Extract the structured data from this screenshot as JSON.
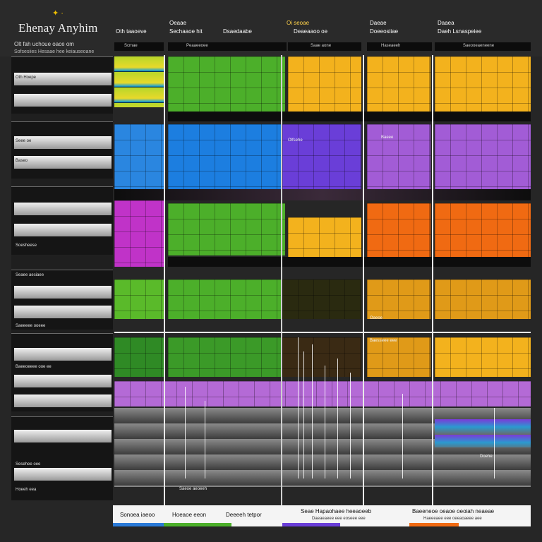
{
  "brand": {
    "title": "Ehenay Anyhim",
    "subtitle": "Olt fah uchoue oace om",
    "subtitle2": "Sofsesiies  Hesaae hee keiauseoane"
  },
  "columns": [
    {
      "title": "Oth taaoeve",
      "sub": "Scmae"
    },
    {
      "title": "Oeaae",
      "title2": "Sechaaoe hit",
      "title3": "Dsaedaabe"
    },
    {
      "title": "Oi seoae",
      "title2": "Deaeaaoo oe"
    },
    {
      "title": "Daeae",
      "title2": "Doeeosiiae"
    },
    {
      "title": "Daaea",
      "title2": "Daeh Lsnaspeiee"
    }
  ],
  "column_subs": [
    "Peaaeeoee",
    "Saae aone",
    "Haseaeeh",
    "Saeooeaeneene"
  ],
  "sidebar": {
    "labels": [
      "Oth Hoepe",
      "Seee oe",
      "Baseo",
      "Soesheese",
      "Seaee aesiaee",
      "Saeeeee ooeee",
      "Baeeoeeee ooe ee",
      "Sesehee oee",
      "Hoeeh eea"
    ]
  },
  "annotations": {
    "grid1": "Olfsehe",
    "grid2": "Baeee",
    "grid3": "Oaeoe",
    "grid4": "Baesseee eee",
    "grid5": "Doehe",
    "grid6": "Saeoe aeoeeh"
  },
  "footer": {
    "c1": "Sonoea iaeoo",
    "c2": "Hoeaoe eeon",
    "c3": "Deeeeh tetpor",
    "c4": "Seae Hapaohaee heeaoeeb",
    "c4sub": "Daeaeaeee eee eoseee eee",
    "c5": "Baeeneoe oeaoe oeoiah neaeae",
    "c5sub": "Haeeeaee eee oeeaoaeee aee"
  },
  "colors": {
    "green": "#4caf2a",
    "yellow": "#f3b21d",
    "blue": "#1c7ee0",
    "purple": "#a25cd6",
    "orange": "#f06a12",
    "magenta": "#c033c8"
  }
}
